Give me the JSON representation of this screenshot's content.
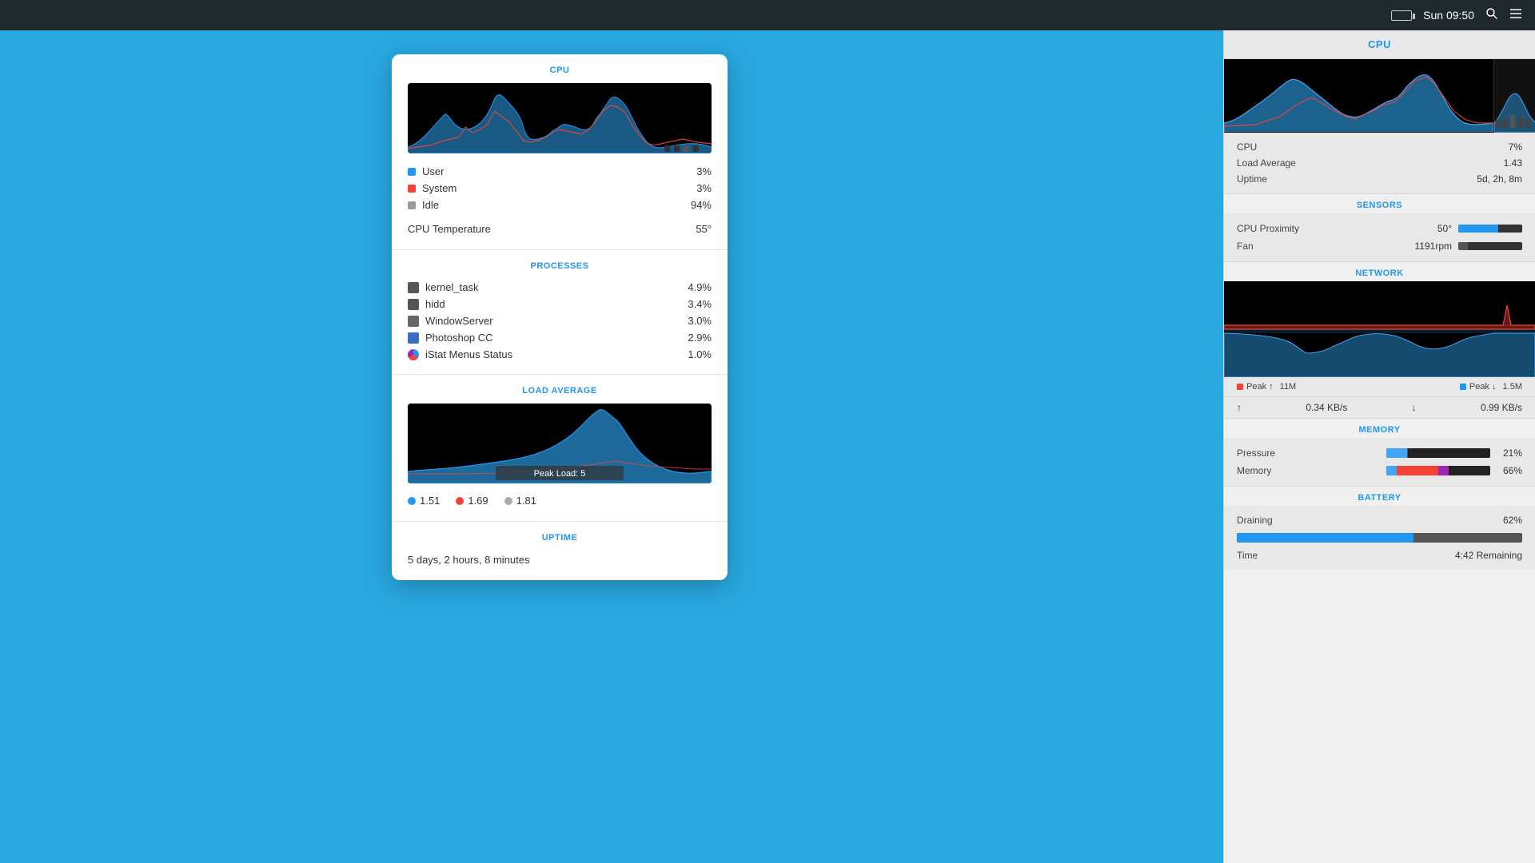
{
  "menubar": {
    "time": "Sun 09:50",
    "search_icon": "🔍",
    "menu_icon": "≡"
  },
  "cpu_panel": {
    "title": "CPU",
    "stats": {
      "user_label": "User",
      "user_value": "3%",
      "system_label": "System",
      "system_value": "3%",
      "idle_label": "Idle",
      "idle_value": "94%",
      "temp_label": "CPU Temperature",
      "temp_value": "55°"
    },
    "processes_title": "PROCESSES",
    "processes": [
      {
        "name": "kernel_task",
        "value": "4.9%",
        "icon": "dark"
      },
      {
        "name": "hidd",
        "value": "3.4%",
        "icon": "dark"
      },
      {
        "name": "WindowServer",
        "value": "3.0%",
        "icon": "dark"
      },
      {
        "name": "Photoshop CC",
        "value": "2.9%",
        "icon": "blue"
      },
      {
        "name": "iStat Menus Status",
        "value": "1.0%",
        "icon": "circle"
      }
    ],
    "load_average_title": "LOAD AVERAGE",
    "peak_load": "Peak Load: 5",
    "load_values": [
      {
        "value": "1.51",
        "color": "#2196f3"
      },
      {
        "value": "1.69",
        "color": "#f44336"
      },
      {
        "value": "1.81",
        "color": "#aaa"
      }
    ],
    "uptime_title": "UPTIME",
    "uptime_value": "5 days, 2 hours, 8 minutes"
  },
  "sidebar": {
    "cpu_title": "CPU",
    "cpu_percent": "7%",
    "cpu_label": "CPU",
    "load_average_label": "Load Average",
    "load_average_value": "1.43",
    "uptime_label": "Uptime",
    "uptime_value": "5d, 2h, 8m",
    "sensors_title": "SENSORS",
    "cpu_proximity_label": "CPU Proximity",
    "cpu_proximity_value": "50°",
    "cpu_proximity_bar": 62,
    "fan_label": "Fan",
    "fan_value": "1191rpm",
    "fan_bar": 15,
    "network_title": "NETWORK",
    "peak_up_label": "Peak ↑",
    "peak_up_value": "11M",
    "peak_down_label": "Peak ↓",
    "peak_down_value": "1.5M",
    "upload_speed": "0.34 KB/s",
    "download_speed": "0.99 KB/s",
    "upload_arrow": "↑",
    "download_arrow": "↓",
    "memory_title": "MEMORY",
    "pressure_label": "Pressure",
    "pressure_value": "21%",
    "memory_label": "Memory",
    "memory_value": "66%",
    "battery_title": "BATTERY",
    "draining_label": "Draining",
    "draining_value": "62%",
    "time_label": "Time",
    "time_remaining": "4:42 Remaining",
    "battery_bar_width": 62
  }
}
